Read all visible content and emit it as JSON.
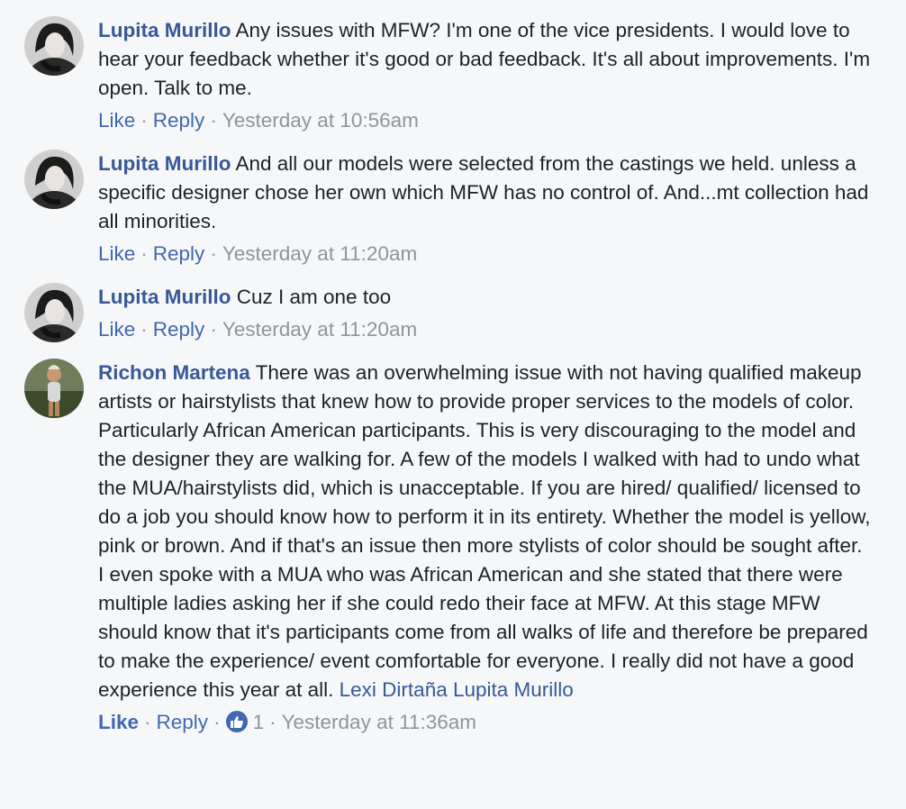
{
  "comments": [
    {
      "author": "Lupita Murillo",
      "text": "Any issues with MFW? I'm one of the vice presidents. I would love to hear your feedback whether it's good or bad feedback. It's all about improvements. I'm open. Talk to me.",
      "like_label": "Like",
      "reply_label": "Reply",
      "timestamp": "Yesterday at 10:56am",
      "avatar": "lupita-avatar"
    },
    {
      "author": "Lupita Murillo",
      "text": "And all our models were selected from the castings we held. unless a specific designer chose her own which MFW has no control of. And...mt collection had all minorities.",
      "like_label": "Like",
      "reply_label": "Reply",
      "timestamp": "Yesterday at 11:20am",
      "avatar": "lupita-avatar"
    },
    {
      "author": "Lupita Murillo",
      "text": "Cuz I am one too",
      "like_label": "Like",
      "reply_label": "Reply",
      "timestamp": "Yesterday at 11:20am",
      "avatar": "lupita-avatar"
    },
    {
      "author": "Richon Martena",
      "text": "There was an overwhelming issue with not having qualified makeup artists or hairstylists that knew how to provide proper services to the models of color. Particularly African American participants. This is very discouraging to the model and the designer they are walking for. A few of the models I walked with had to undo what the MUA/hairstylists did, which is unacceptable. If you are hired/ qualified/ licensed to do a job you should know how to perform it in its entirety. Whether the model is yellow, pink or brown. And if that's an issue then more stylists of color should be sought after. I even spoke with a MUA who was African American and she stated that there were multiple ladies asking her if she could redo their face at MFW. At this stage MFW should know that it's participants come from all walks of life and therefore be prepared to make the experience/ event comfortable for everyone. I really did not have a good experience this year at all.",
      "tag_1": "Lexi Dirtaña",
      "tag_2": "Lupita Murillo",
      "like_label": "Like",
      "reply_label": "Reply",
      "reaction_count": "1",
      "reaction_icon": "thumbs-up-icon",
      "timestamp": "Yesterday at 11:36am",
      "avatar": "richon-avatar"
    }
  ],
  "colors": {
    "author": "#385898",
    "action": "#4267b2",
    "meta": "#90949c",
    "text": "#1d2129",
    "background": "#f6f7f9"
  }
}
